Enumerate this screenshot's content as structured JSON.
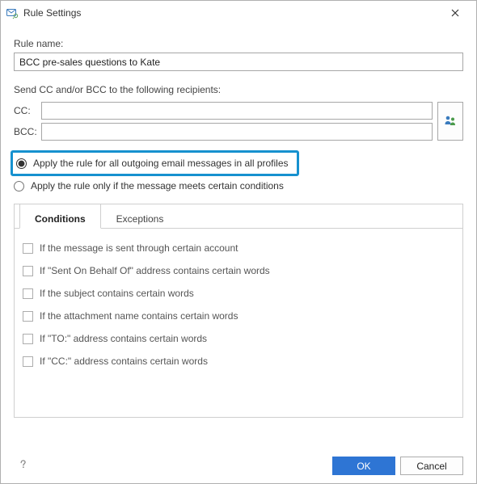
{
  "window": {
    "title": "Rule Settings"
  },
  "form": {
    "rule_name_label": "Rule name:",
    "rule_name_value": "BCC pre-sales questions to Kate",
    "recipients_label": "Send CC and/or BCC to the following recipients:",
    "cc_label": "CC:",
    "cc_value": "",
    "bcc_label": "BCC:",
    "bcc_value": ""
  },
  "radios": {
    "opt_all": "Apply the rule for all outgoing email messages in all profiles",
    "opt_cond": "Apply the rule only if the message meets certain conditions",
    "selected": "all"
  },
  "tabs": {
    "conditions": "Conditions",
    "exceptions": "Exceptions",
    "active": "conditions"
  },
  "conditions": [
    "If the message is sent through certain account",
    "If \"Sent On Behalf Of\" address contains certain words",
    "If the subject contains certain words",
    "If the attachment name contains certain words",
    "If \"TO:\" address contains certain words",
    "If \"CC:\" address contains certain words"
  ],
  "buttons": {
    "ok": "OK",
    "cancel": "Cancel"
  }
}
